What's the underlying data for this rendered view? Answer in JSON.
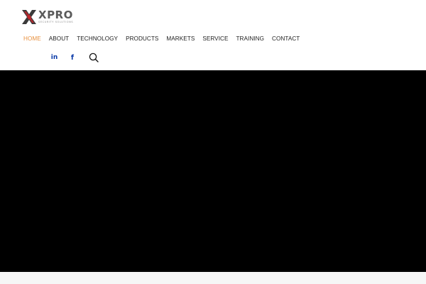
{
  "brand": {
    "name": "XPRO",
    "tagline": "SECURITY SOLUTIONS",
    "mark_colors": {
      "dark": "#3a3a3a",
      "red": "#c0272d"
    }
  },
  "nav": {
    "items": [
      {
        "label": "HOME",
        "active": true
      },
      {
        "label": "ABOUT",
        "active": false
      },
      {
        "label": "TECHNOLOGY",
        "active": false
      },
      {
        "label": "PRODUCTS",
        "active": false
      },
      {
        "label": "MARKETS",
        "active": false
      },
      {
        "label": "SERVICE",
        "active": false
      },
      {
        "label": "TRAINING",
        "active": false
      },
      {
        "label": "CONTACT",
        "active": false
      }
    ],
    "active_color": "#e8913f",
    "text_color": "#1f1f1f"
  },
  "social": {
    "linkedin_glyph": "in",
    "facebook_glyph": "f",
    "icons": [
      "linkedin-icon",
      "facebook-icon",
      "search-icon"
    ],
    "color": "#0a3aa8"
  },
  "hero": {
    "background": "#000000"
  }
}
